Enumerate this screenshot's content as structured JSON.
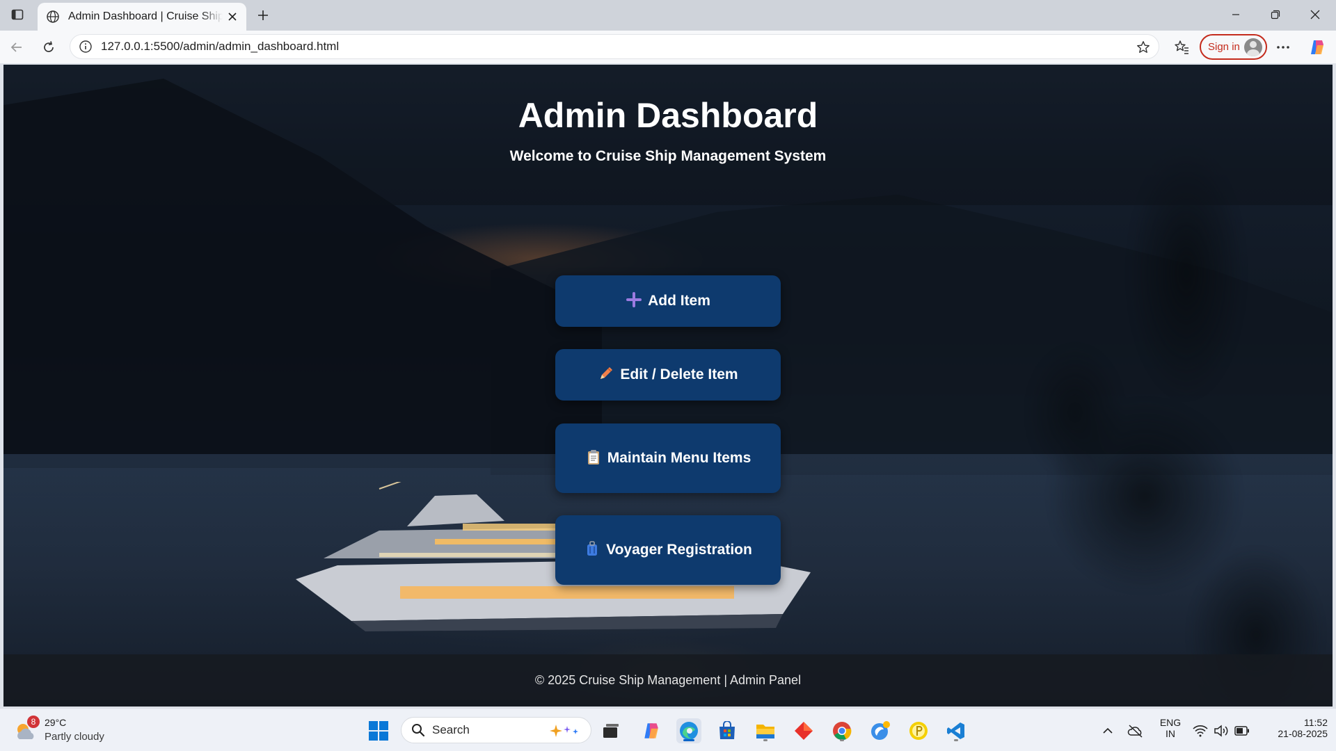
{
  "browser": {
    "tab_title": "Admin Dashboard | Cruise Ship Management",
    "url": "127.0.0.1:5500/admin/admin_dashboard.html",
    "signin_label": "Sign in"
  },
  "page": {
    "title": "Admin Dashboard",
    "subtitle": "Welcome to Cruise Ship Management System",
    "buttons": [
      {
        "icon": "plus-icon",
        "label": "Add Item"
      },
      {
        "icon": "pencil-icon",
        "label": "Edit / Delete Item"
      },
      {
        "icon": "clipboard-icon",
        "label": "Maintain Menu Items"
      },
      {
        "icon": "luggage-icon",
        "label": "Voyager Registration"
      }
    ],
    "footer": "© 2025 Cruise Ship Management | Admin Panel"
  },
  "taskbar": {
    "weather_badge": "8",
    "weather_temp": "29°C",
    "weather_desc": "Partly cloudy",
    "search_label": "Search",
    "lang_top": "ENG",
    "lang_bottom": "IN",
    "time": "11:52",
    "date": "21-08-2025"
  },
  "colors": {
    "button_bg": "#0e3a6e",
    "signin_accent": "#c42b1c"
  }
}
